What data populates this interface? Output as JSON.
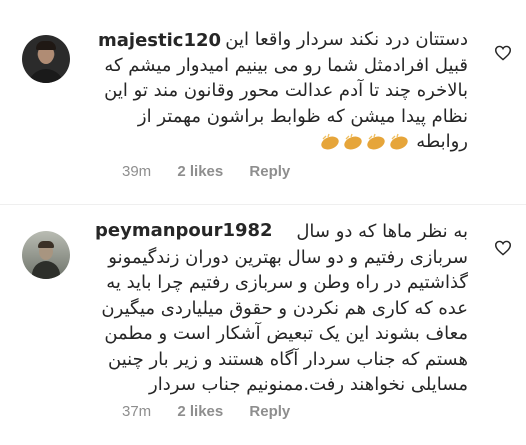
{
  "comments": [
    {
      "username": "majestic120",
      "lines": [
        "دستتان درد نکند سردار واقعا این",
        "قبیل افرادمثل شما رو می بینیم امیدوار میشم که",
        "بالاخره چند تا آدم عدالت محور وقانون مند تو این",
        "نظام پیدا میشن که ظوابط براشون مهمتر از",
        "روابطه"
      ],
      "emoji_name": "clapping-hands",
      "emoji_count": 4,
      "time": "39m",
      "likes": "2 likes",
      "reply": "Reply"
    },
    {
      "username": "peymanpour1982",
      "lines": [
        "به نظر ماها که دو سال",
        "سربازی رفتیم و دو سال بهترین دوران زندگیمونو",
        "گذاشتیم در راه وطن و سربازی رفتیم چرا باید یه",
        "عده که کاری هم نکردن و حقوق میلیاردی میگیرن",
        "معاف بشوند این یک تبعیض آشکار است و مطمن",
        "هستم که جناب سردار آگاه هستند و زیر بار چنین",
        "مسایلی نخواهند رفت.ممنونیم جناب سردار"
      ],
      "time": "37m",
      "likes": "2 likes",
      "reply": "Reply"
    }
  ],
  "icons": {
    "like": "heart-icon",
    "avatar": "avatar"
  },
  "colors": {
    "text": "#262626",
    "meta": "#8e8e8e",
    "emoji": "#e6a53a"
  }
}
